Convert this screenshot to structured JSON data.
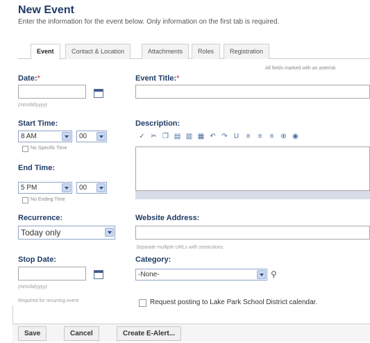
{
  "page": {
    "title": "New Event",
    "subtitle": "Enter the information for the event below. Only information on the first tab is required."
  },
  "tabs": [
    {
      "label": "Event",
      "active": true
    },
    {
      "label": "Contact & Location"
    },
    {
      "label": "Attachments"
    },
    {
      "label": "Roles"
    },
    {
      "label": "Registration"
    }
  ],
  "form": {
    "required_note": "All fields marked with an asterisk",
    "date": {
      "label": "Date:",
      "required_mark": "*",
      "value": "",
      "hint": "(mm/dd/yyyy)",
      "icon": "calendar-icon"
    },
    "event_title": {
      "label": "Event Title:",
      "required_mark": "*",
      "value": ""
    },
    "start_time": {
      "label": "Start Time:",
      "hour": "8 AM",
      "minute": "00",
      "no_specific_time": "No Specific Time"
    },
    "description": {
      "label": "Description:",
      "toolbar_icons": [
        "spellcheck-icon",
        "cut-icon",
        "copy-icon",
        "paste-icon",
        "paste-text-icon",
        "paste-word-icon",
        "undo-icon",
        "redo-icon",
        "underline-icon",
        "align-left-icon",
        "align-center-icon",
        "align-right-icon",
        "link-icon",
        "image-icon"
      ]
    },
    "end_time": {
      "label": "End Time:",
      "hour": "5 PM",
      "minute": "00",
      "no_ending_time": "No Ending Time"
    },
    "recurrence": {
      "label": "Recurrence:",
      "value": "Today only"
    },
    "website": {
      "label": "Website Address:",
      "value": "",
      "hint": "Separate multiple URLs with semicolons."
    },
    "stop_date": {
      "label": "Stop Date:",
      "value": "",
      "hint": "(mm/dd/yyyy)",
      "note": "Required for recurring event"
    },
    "category": {
      "label": "Category:",
      "value": "-None-"
    },
    "request_posting": {
      "label": "Request posting to Lake Park School District calendar.",
      "checked": false
    }
  },
  "buttons": {
    "save": "Save",
    "cancel": "Cancel",
    "create_alert": "Create E-Alert..."
  },
  "colors": {
    "label_blue": "#1f3b66",
    "required_red": "#c62828",
    "select_border": "#8ea3c9"
  }
}
